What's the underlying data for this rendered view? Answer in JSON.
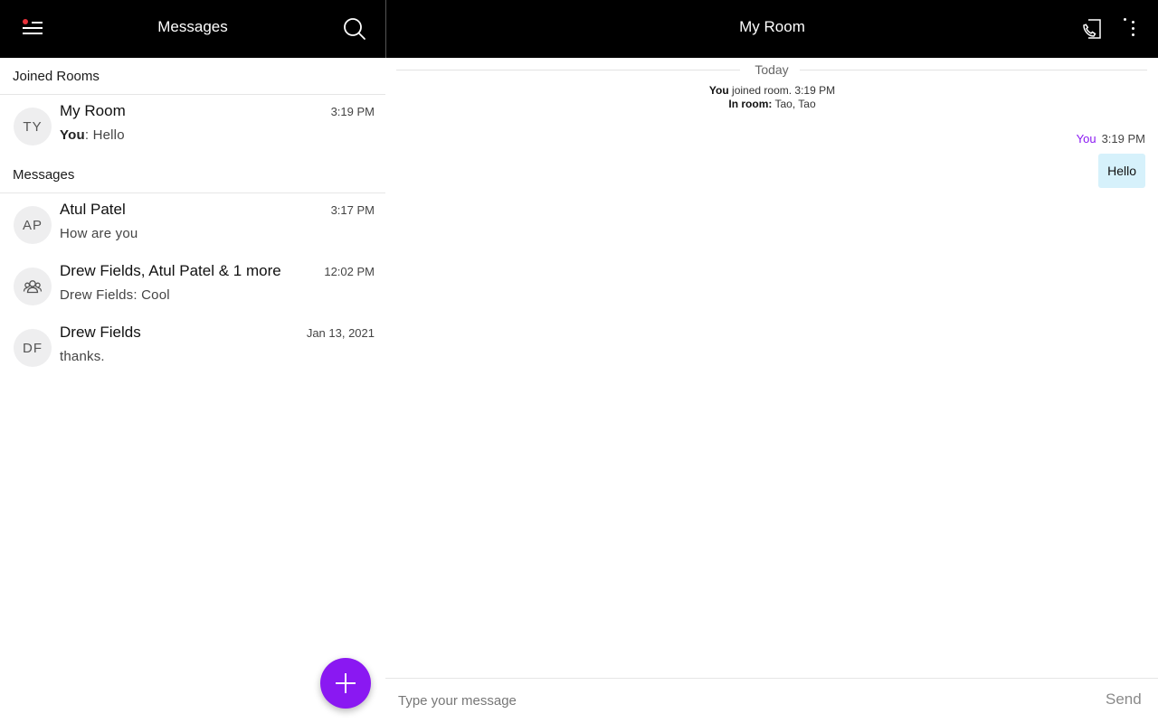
{
  "left_pane": {
    "title": "Messages",
    "menu_icon": "hamburger-menu-icon",
    "notification_dot_color": "#e8313a",
    "search_icon": "search-icon",
    "joined_rooms_label": "Joined Rooms",
    "rooms": [
      {
        "initials": "TY",
        "name": "My Room",
        "sender": "You",
        "preview_text": ": Hello",
        "time": "3:19 PM"
      }
    ],
    "messages_label": "Messages",
    "conversations": [
      {
        "initials": "AP",
        "name": "Atul Patel",
        "preview": "How are you",
        "time": "3:17 PM"
      },
      {
        "icon": "group-icon",
        "name": "Drew Fields, Atul Patel & 1 more",
        "preview": "Drew Fields: Cool",
        "time": "12:02 PM"
      },
      {
        "initials": "DF",
        "name": "Drew Fields",
        "preview": "thanks.",
        "time": "Jan 13, 2021"
      }
    ],
    "fab_icon": "plus-icon",
    "accent_color": "#8a18f2"
  },
  "chat": {
    "title": "My Room",
    "call_icon": "phone-call-icon",
    "more_icon": "more-vertical-icon",
    "day_separator": "Today",
    "system_event": {
      "actor": "You",
      "text": "joined room. 3:19 PM"
    },
    "in_room": {
      "label": "In room:",
      "members": "Tao, Tao"
    },
    "messages": [
      {
        "sender": "You",
        "time": "3:19 PM",
        "text": "Hello",
        "bubble_color": "#d6f1fb"
      }
    ],
    "composer": {
      "placeholder": "Type your message",
      "value": "",
      "send_label": "Send"
    }
  }
}
